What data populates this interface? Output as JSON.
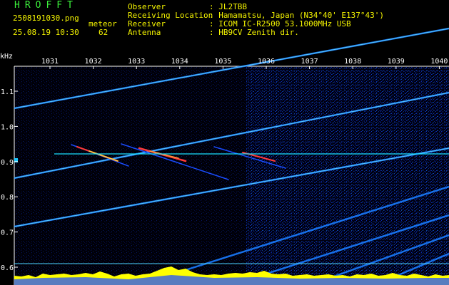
{
  "header": {
    "app_name": "HROFFT",
    "filename": "2508191030.png",
    "timestamp": "25.08.19 10:30",
    "meteor_label": "meteor",
    "meteor_count": "62",
    "observer_label": "Observer",
    "observer_value": ": JL2TBB",
    "location_label": "Receiving Location",
    "location_value": ": Hamamatsu, Japan (N34°40' E137°43')",
    "receiver_label": "Receiver",
    "receiver_value": ": ICOM IC-R2500 53.1000MHz USB",
    "antenna_label": "Antenna",
    "antenna_value": ": HB9CV Zenith dir."
  },
  "axes": {
    "y_unit": "kHz",
    "x_ticks": [
      "1031",
      "1032",
      "1033",
      "1034",
      "1035",
      "1036",
      "1037",
      "1038",
      "1039",
      "1040"
    ],
    "y_ticks": [
      "1.1",
      "1.0",
      "0.9",
      "0.8",
      "0.7",
      "0.6"
    ]
  },
  "colors": {
    "background": "#000000",
    "header_text": "#f4f400",
    "title_green": "#3cf23c",
    "noise_dark": "#00008c",
    "signal_cyan": "#19e0ff",
    "echo_red": "#ff3a3a",
    "spectrum_yellow": "#ffff00"
  }
}
